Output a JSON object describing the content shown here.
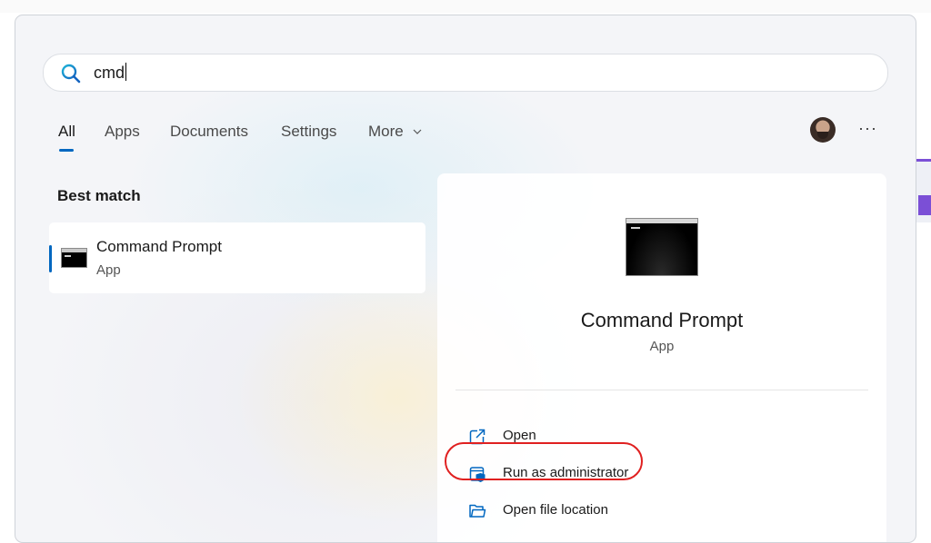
{
  "search": {
    "query": "cmd"
  },
  "tabs": [
    {
      "label": "All"
    },
    {
      "label": "Apps"
    },
    {
      "label": "Documents"
    },
    {
      "label": "Settings"
    },
    {
      "label": "More"
    }
  ],
  "header": {
    "more_options": "···"
  },
  "results": {
    "section_title": "Best match",
    "best_match": {
      "title": "Command Prompt",
      "subtitle": "App"
    }
  },
  "detail": {
    "title": "Command Prompt",
    "subtitle": "App",
    "actions": [
      {
        "label": "Open",
        "icon": "open-external-icon"
      },
      {
        "label": "Run as administrator",
        "icon": "shield-icon"
      },
      {
        "label": "Open file location",
        "icon": "folder-icon"
      }
    ]
  },
  "colors": {
    "accent": "#0067c0",
    "highlight": "#e02020"
  }
}
